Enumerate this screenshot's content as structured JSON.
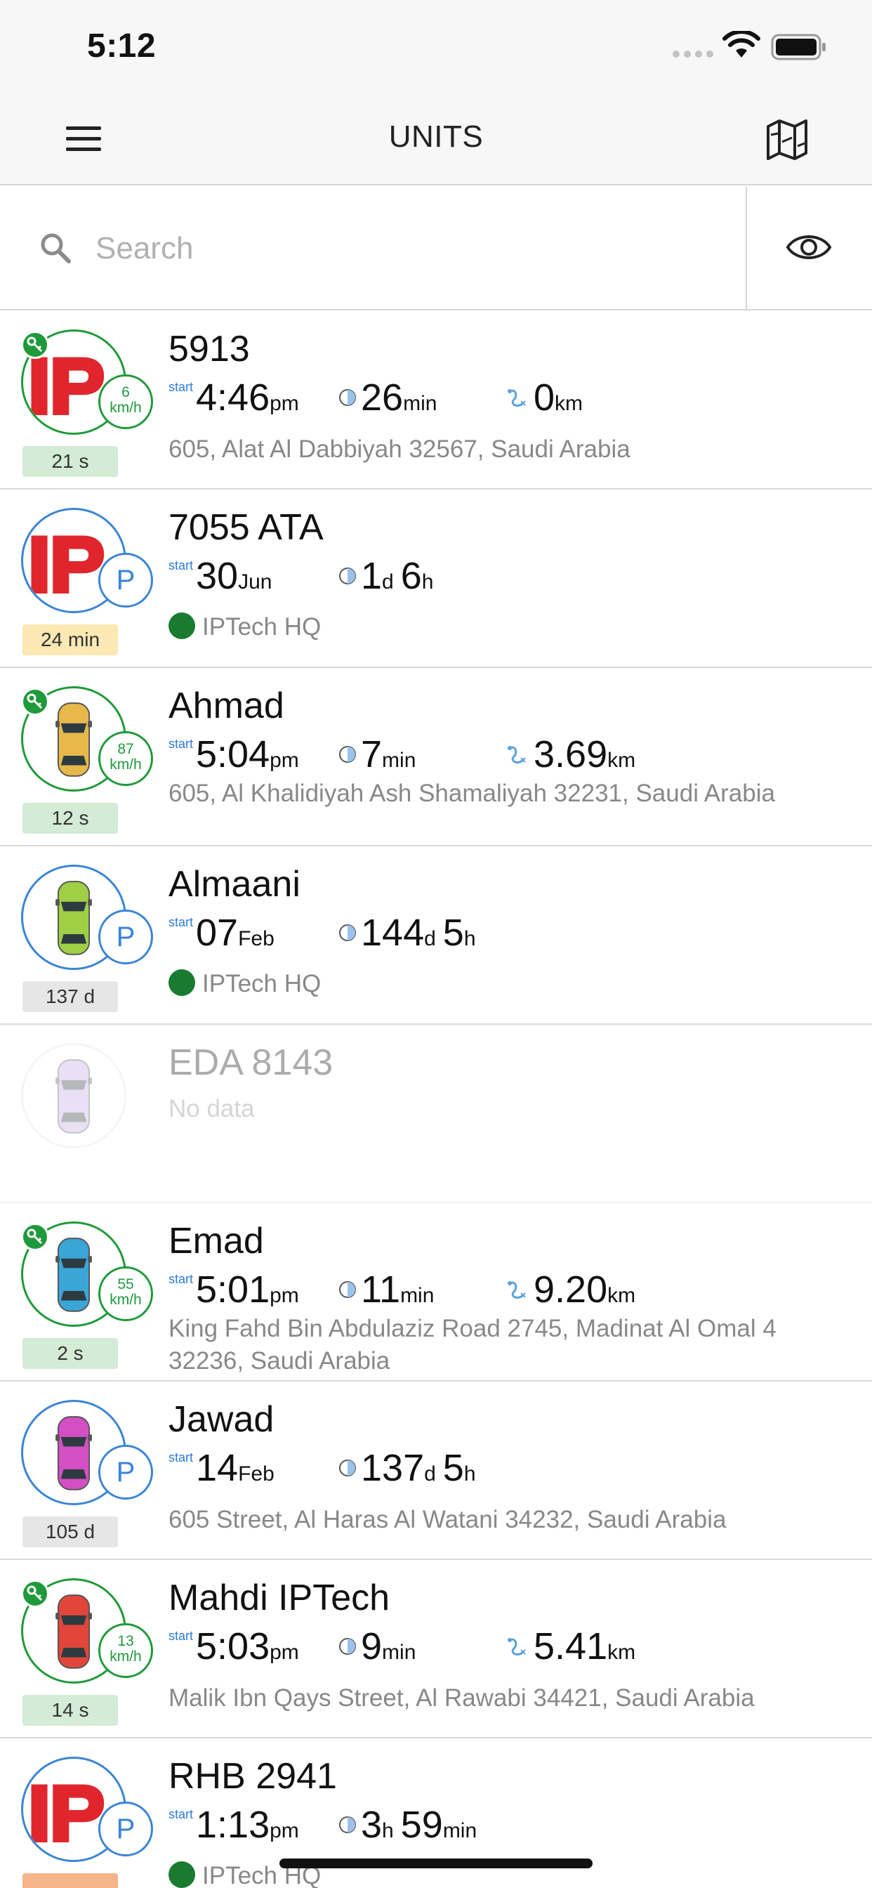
{
  "status_bar": {
    "time": "5:12"
  },
  "nav": {
    "title": "UNITS"
  },
  "search": {
    "placeholder": "Search"
  },
  "units": [
    {
      "name": "5913",
      "state": "moving",
      "avatar": "logo",
      "speed": "6",
      "speed_unit": "km/h",
      "age": "21 s",
      "age_color": "green",
      "start_label": "start",
      "start_value": "4:46",
      "start_unit": "pm",
      "duration": [
        [
          "26",
          "min"
        ]
      ],
      "distance": "0",
      "distance_unit": "km",
      "address": "605, Alat Al Dabbiyah 32567, Saudi Arabia"
    },
    {
      "name": "7055 ATA",
      "state": "parked",
      "avatar": "logo",
      "age": "24 min",
      "age_color": "yellow",
      "start_label": "start",
      "start_value": "30",
      "start_unit": "Jun",
      "duration": [
        [
          "1",
          "d"
        ],
        [
          "6",
          "h"
        ]
      ],
      "location": "IPTech HQ"
    },
    {
      "name": "Ahmad",
      "state": "moving",
      "avatar": "car",
      "car_color": "#e6b94a",
      "speed": "87",
      "speed_unit": "km/h",
      "age": "12 s",
      "age_color": "green",
      "start_label": "start",
      "start_value": "5:04",
      "start_unit": "pm",
      "duration": [
        [
          "7",
          "min"
        ]
      ],
      "distance": "3.69",
      "distance_unit": "km",
      "address": "605, Al Khalidiyah Ash Shamaliyah 32231, Saudi Arabia"
    },
    {
      "name": "Almaani",
      "state": "parked",
      "avatar": "car",
      "car_color": "#9fcf45",
      "age": "137 d",
      "age_color": "grey",
      "start_label": "start",
      "start_value": "07",
      "start_unit": "Feb",
      "duration": [
        [
          "144",
          "d"
        ],
        [
          "5",
          "h"
        ]
      ],
      "location": "IPTech HQ"
    },
    {
      "name": "EDA 8143",
      "state": "nodata",
      "avatar": "car",
      "car_color": "#c6a8e6",
      "message": "No data"
    },
    {
      "name": "Emad",
      "state": "moving",
      "avatar": "car",
      "car_color": "#3aa6d8",
      "speed": "55",
      "speed_unit": "km/h",
      "age": "2 s",
      "age_color": "green",
      "start_label": "start",
      "start_value": "5:01",
      "start_unit": "pm",
      "duration": [
        [
          "11",
          "min"
        ]
      ],
      "distance": "9.20",
      "distance_unit": "km",
      "address": "King Fahd Bin Abdulaziz Road 2745, Madinat Al Omal 4 32236, Saudi Arabia"
    },
    {
      "name": "Jawad",
      "state": "parked",
      "avatar": "car",
      "car_color": "#d44fc4",
      "age": "105 d",
      "age_color": "grey",
      "start_label": "start",
      "start_value": "14",
      "start_unit": "Feb",
      "duration": [
        [
          "137",
          "d"
        ],
        [
          "5",
          "h"
        ]
      ],
      "address": "605 Street, Al Haras Al Watani 34232, Saudi Arabia"
    },
    {
      "name": "Mahdi IPTech",
      "state": "moving",
      "avatar": "car",
      "car_color": "#e2463a",
      "speed": "13",
      "speed_unit": "km/h",
      "age": "14 s",
      "age_color": "green",
      "start_label": "start",
      "start_value": "5:03",
      "start_unit": "pm",
      "duration": [
        [
          "9",
          "min"
        ]
      ],
      "distance": "5.41",
      "distance_unit": "km",
      "address": "Malik Ibn Qays Street, Al Rawabi 34421, Saudi Arabia"
    },
    {
      "name": "RHB 2941",
      "state": "parked",
      "avatar": "logo",
      "age": "",
      "age_color": "orange",
      "start_label": "start",
      "start_value": "1:13",
      "start_unit": "pm",
      "duration": [
        [
          "3",
          "h"
        ],
        [
          "59",
          "min"
        ]
      ],
      "location": "IPTech HQ"
    }
  ],
  "colors": {
    "moving": "#1f9a3a",
    "parked": "#3a85d6",
    "label_blue": "#2c7bd8",
    "logo_red": "#e0262c"
  }
}
